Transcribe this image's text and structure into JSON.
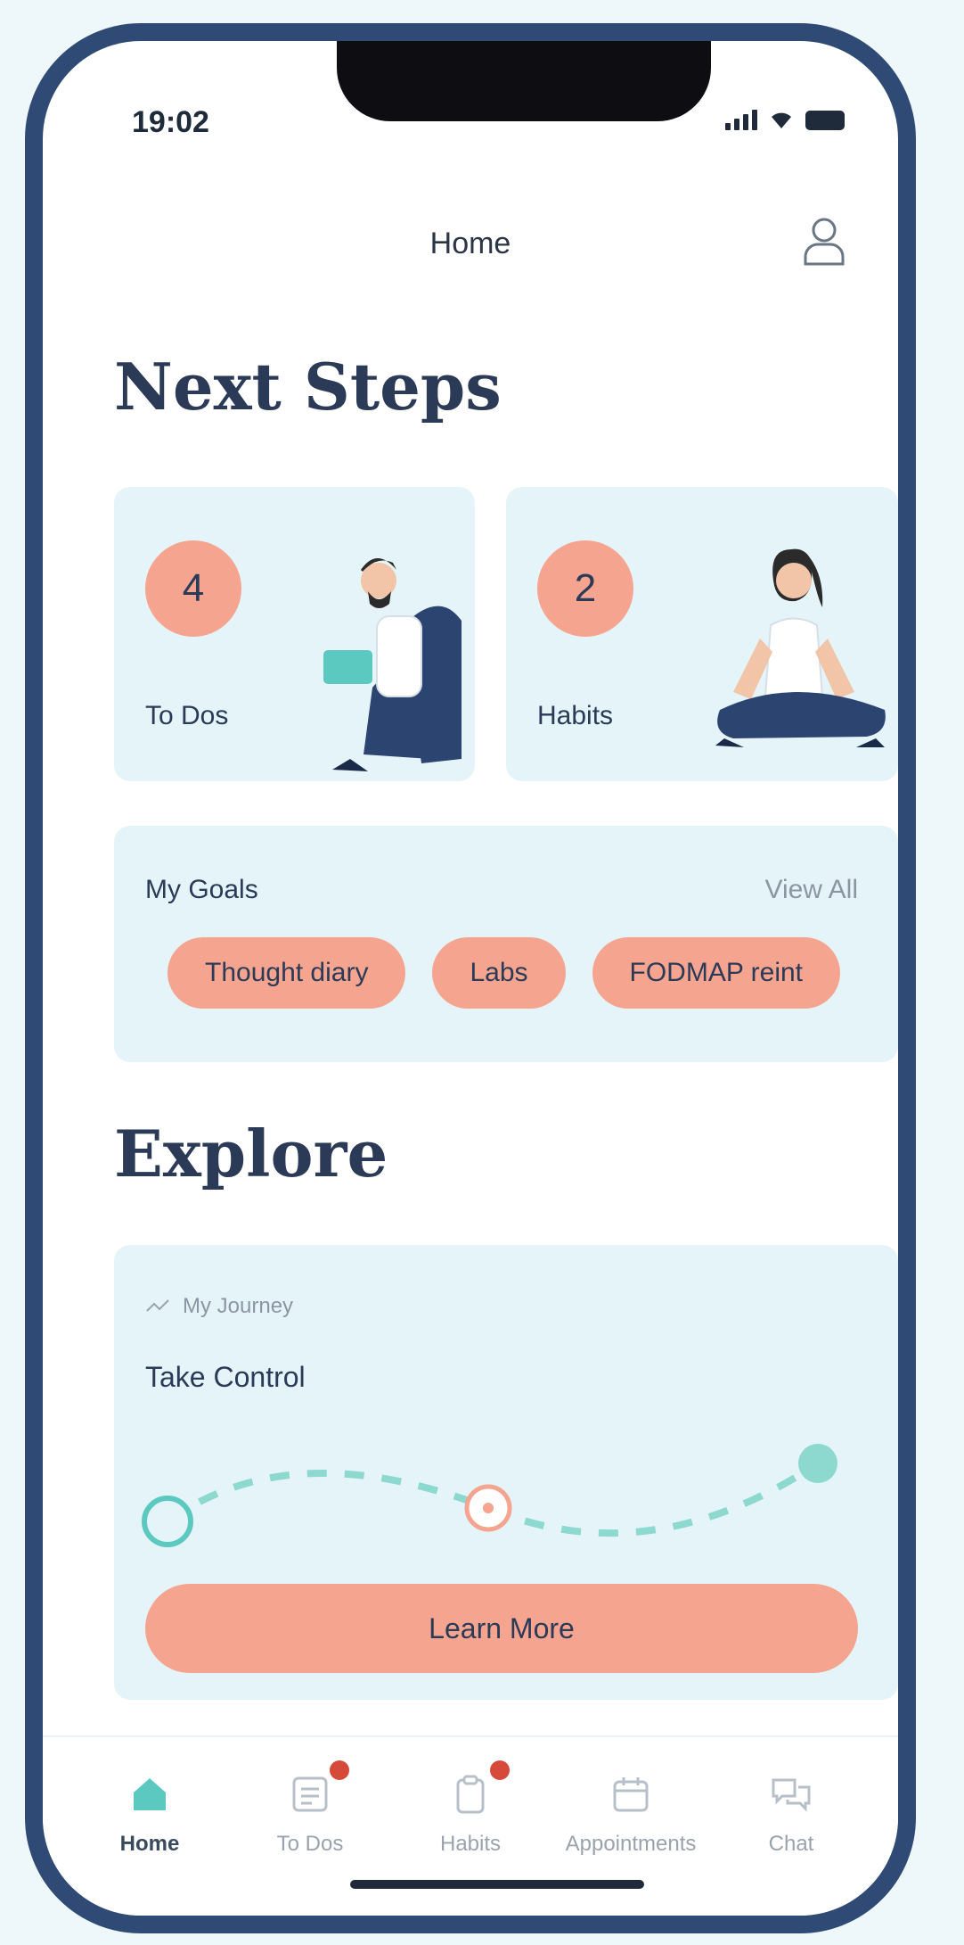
{
  "status": {
    "time": "19:02"
  },
  "header": {
    "title": "Home"
  },
  "next_steps": {
    "heading": "Next Steps",
    "cards": [
      {
        "count": "4",
        "label": "To Dos"
      },
      {
        "count": "2",
        "label": "Habits"
      }
    ]
  },
  "goals": {
    "title": "My Goals",
    "view_all": "View All",
    "chips": [
      "Thought diary",
      "Labs",
      "FODMAP reint"
    ]
  },
  "explore": {
    "heading": "Explore",
    "tag": "My Journey",
    "title": "Take Control",
    "button": "Learn More"
  },
  "tabbar": {
    "items": [
      {
        "label": "Home",
        "icon": "home-icon",
        "active": true
      },
      {
        "label": "To Dos",
        "icon": "list-icon",
        "badge": true
      },
      {
        "label": "Habits",
        "icon": "clipboard-icon",
        "badge": true
      },
      {
        "label": "Appointments",
        "icon": "calendar-icon"
      },
      {
        "label": "Chat",
        "icon": "chat-icon"
      }
    ]
  },
  "colors": {
    "frame": "#2f4a75",
    "accent": "#f5a58f",
    "card_bg": "#e5f4f9",
    "heading": "#2b3a56",
    "teal": "#5cc9c0"
  }
}
